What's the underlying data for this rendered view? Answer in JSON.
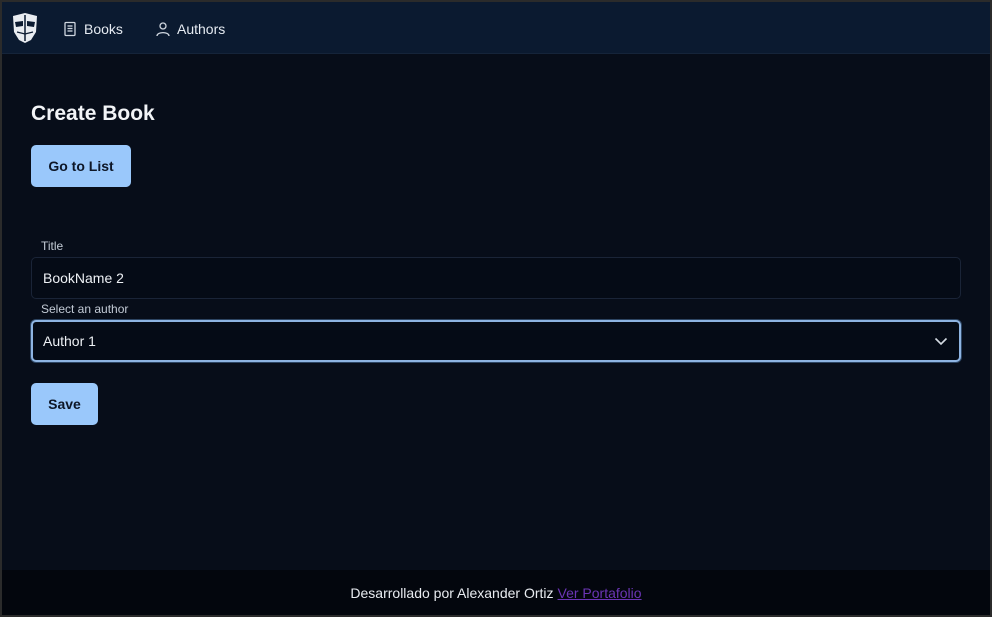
{
  "nav": {
    "books_label": "Books",
    "authors_label": "Authors"
  },
  "page": {
    "title": "Create Book",
    "go_to_list_label": "Go to List"
  },
  "form": {
    "title_label": "Title",
    "title_value": "BookName 2",
    "author_label": "Select an author",
    "author_value": "Author 1",
    "save_label": "Save"
  },
  "footer": {
    "text": "Desarrollado por Alexander Ortiz",
    "link_label": "Ver Portafolio"
  },
  "colors": {
    "accent": "#9ac8fb",
    "background": "#070d19",
    "navbar": "#0b1a30",
    "footer_link": "#6b35b5"
  },
  "icons": {
    "logo": "mask-logo-icon",
    "books": "book-icon",
    "authors": "user-icon",
    "select": "chevron-down-icon"
  }
}
